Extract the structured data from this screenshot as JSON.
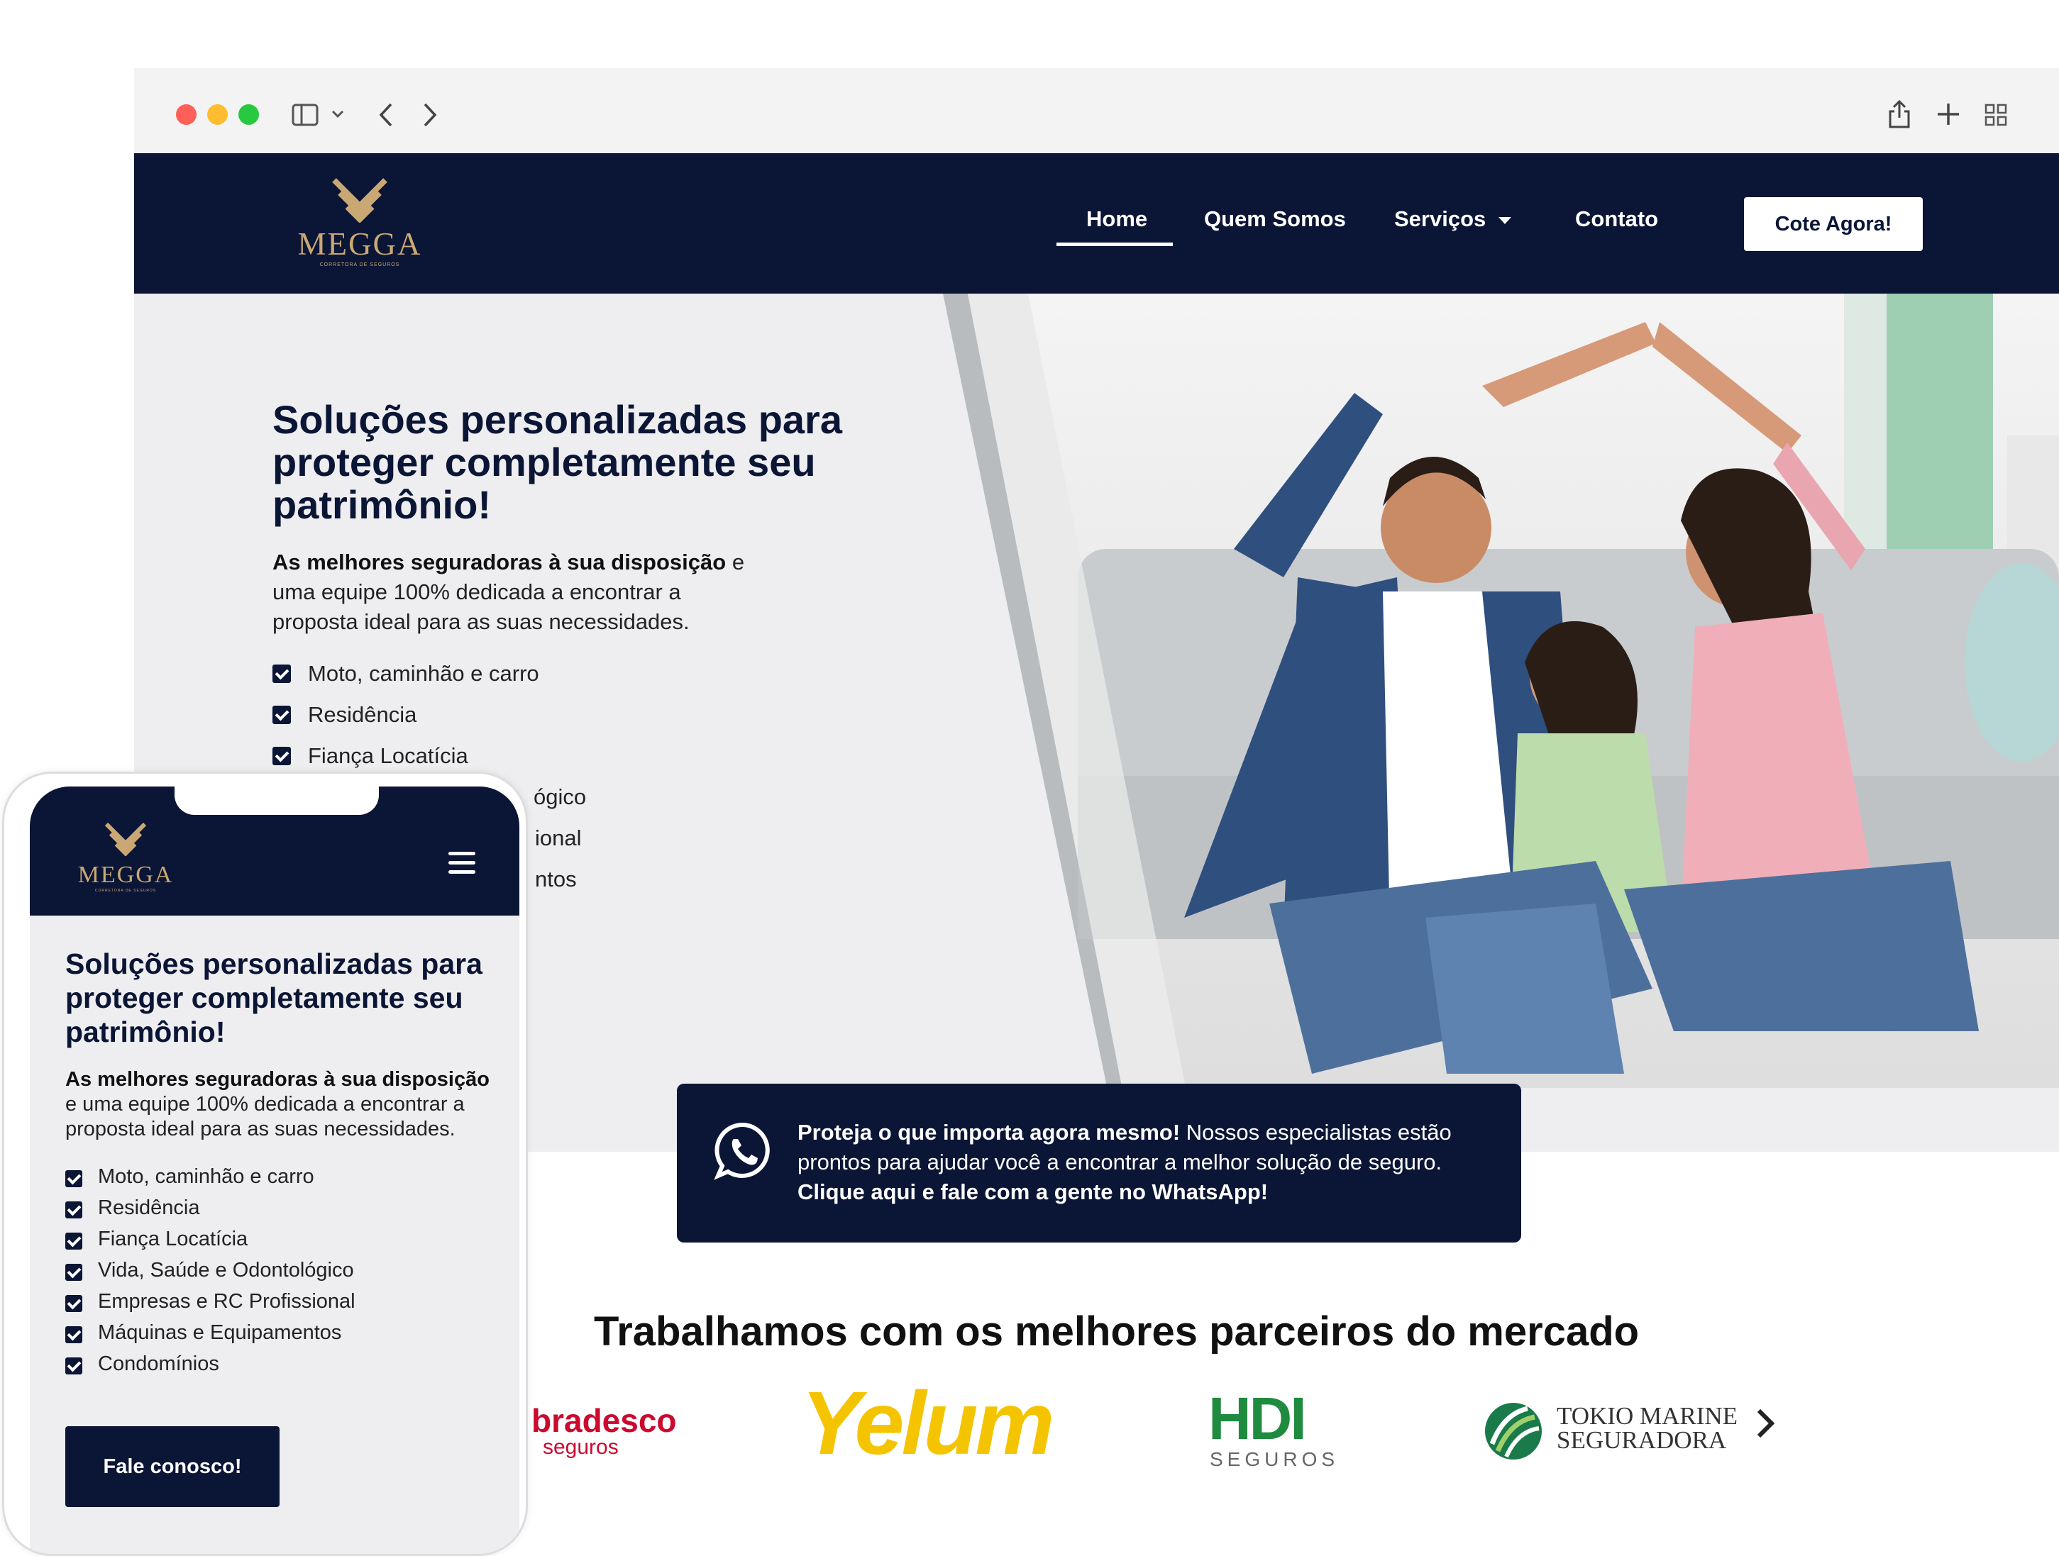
{
  "browser": {
    "toolbar_icons": [
      "sidebar-icon",
      "chevron-down-icon",
      "back-icon",
      "forward-icon",
      "share-icon",
      "new-tab-icon",
      "tab-overview-icon"
    ]
  },
  "site": {
    "logo": {
      "name": "MEGGA",
      "tagline": "CORRETORA DE SEGUROS"
    },
    "nav": {
      "home": "Home",
      "about": "Quem Somos",
      "services": "Serviços",
      "contact": "Contato",
      "cta": "Cote Agora!"
    },
    "hero": {
      "title": "Soluções personalizadas para proteger completamente seu patrimônio!",
      "desc_bold": "As melhores seguradoras à sua disposição",
      "desc_rest": " e uma equipe 100% dedicada a encontrar a proposta ideal para as suas necessidades.",
      "visible_items": [
        "Moto, caminhão e carro",
        "Residência",
        "Fiança Locatícia"
      ],
      "partial_items": [
        "ógico",
        "ional",
        "ntos"
      ]
    },
    "whatsapp": {
      "bold": "Proteja o que importa agora mesmo!",
      "text": " Nossos especialistas estão prontos para ajudar você a encontrar a melhor solução de seguro.",
      "cta": "Clique aqui e fale com a gente no WhatsApp!"
    },
    "partners": {
      "title": "Trabalhamos com os melhores parceiros do mercado",
      "bradesco": {
        "name": "bradesco",
        "sub": "seguros"
      },
      "yelum": "Yelum",
      "hdi": {
        "name": "HDI",
        "sub": "SEGUROS"
      },
      "tokio": {
        "line1": "TOKIO MARINE",
        "line2": "SEGURADORA"
      },
      "next_icon": "chevron-right-icon"
    }
  },
  "mobile": {
    "logo": {
      "name": "MEGGA",
      "tagline": "CORRETORA DE SEGUROS"
    },
    "menu_icon": "hamburger-icon",
    "title": "Soluções personalizadas para proteger completamente seu patrimônio!",
    "desc_bold": "As melhores seguradoras à sua disposição",
    "desc_rest": " e uma equipe 100% dedicada a encontrar a proposta ideal para as suas necessidades.",
    "items": [
      "Moto, caminhão e carro",
      "Residência",
      "Fiança Locatícia",
      "Vida, Saúde e Odontológico",
      "Empresas e RC Profissional",
      "Máquinas e Equipamentos",
      "Condomínios"
    ],
    "button": "Fale conosco!"
  },
  "colors": {
    "navy": "#0b1535",
    "gold": "#c9a874",
    "hero_bg": "#eeeef0",
    "bradesco_red": "#cc092f",
    "yelum_yellow": "#f5c400",
    "hdi_green": "#1f8b3f"
  }
}
